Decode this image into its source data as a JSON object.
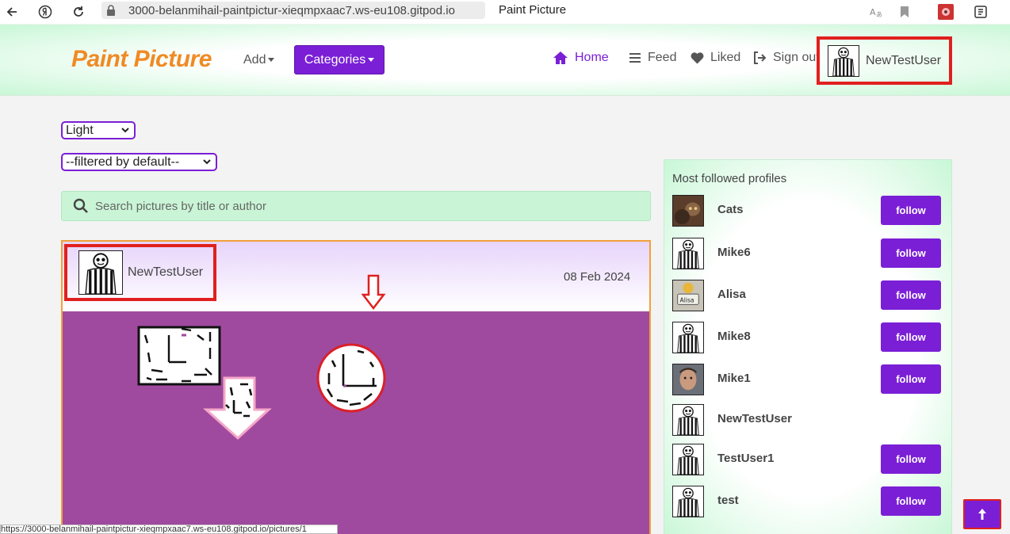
{
  "browser": {
    "url": "3000-belanmihail-paintpictur-xieqmpxaac7.ws-eu108.gitpod.io",
    "tab_title": "Paint Picture",
    "status_url": "https://3000-belanmihail-paintpictur-xieqmpxaac7.ws-eu108.gitpod.io/pictures/1"
  },
  "navbar": {
    "brand": "Paint Picture",
    "add_label": "Add",
    "categories_label": "Categories",
    "home_label": "Home",
    "feed_label": "Feed",
    "liked_label": "Liked",
    "signout_label": "Sign out",
    "username": "NewTestUser"
  },
  "controls": {
    "theme_value": "Light",
    "filter_value": "--filtered by default--",
    "search_placeholder": "Search pictures by title or author"
  },
  "post": {
    "author": "NewTestUser",
    "date": "08 Feb 2024",
    "canvas_color": "#a04a9f"
  },
  "sidebar": {
    "title": "Most followed profiles",
    "profiles": [
      {
        "name": "Cats",
        "button": "follow",
        "avatar": "cat-photo"
      },
      {
        "name": "Mike6",
        "button": "follow",
        "avatar": "striped-figure"
      },
      {
        "name": "Alisa",
        "button": "follow",
        "avatar": "toy-photo"
      },
      {
        "name": "Mike8",
        "button": "follow",
        "avatar": "striped-figure"
      },
      {
        "name": "Mike1",
        "button": "follow",
        "avatar": "face-photo"
      },
      {
        "name": "NewTestUser",
        "button": "",
        "avatar": "striped-figure"
      },
      {
        "name": "TestUser1",
        "button": "follow",
        "avatar": "striped-figure"
      },
      {
        "name": "test",
        "button": "follow",
        "avatar": "striped-figure"
      }
    ]
  },
  "colors": {
    "accent": "#7a1fd6",
    "brand": "#f08a24",
    "highlight": "#e0201e",
    "nav_bg": "#c8f7d6"
  }
}
